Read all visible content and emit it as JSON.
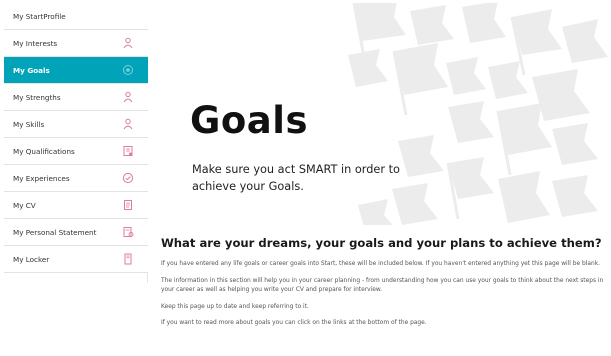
{
  "sidebar": {
    "items": [
      {
        "label": "My StartProfile",
        "icon": ""
      },
      {
        "label": "My Interests",
        "icon": "person-icon"
      },
      {
        "label": "My Goals",
        "icon": "goal-icon",
        "active": true
      },
      {
        "label": "My Strengths",
        "icon": "person-icon"
      },
      {
        "label": "My Skills",
        "icon": "person-icon"
      },
      {
        "label": "My Qualifications",
        "icon": "certificate-icon"
      },
      {
        "label": "My Experiences",
        "icon": "check-circle-icon"
      },
      {
        "label": "My CV",
        "icon": "document-icon"
      },
      {
        "label": "My Personal Statement",
        "icon": "statement-icon"
      },
      {
        "label": "My Locker",
        "icon": "locker-icon"
      }
    ]
  },
  "hero": {
    "title": "Goals",
    "subtitle": "Make sure you act SMART in order to achieve your Goals."
  },
  "content": {
    "heading": "What are your dreams, your goals and your plans to achieve them?",
    "paragraphs": [
      "If you have entered any life goals or career goals into Start, these will be included below.  If you haven't entered anything yet this page will be blank.",
      "The information in this section will help you in your career planning - from understanding how you can use your goals to think about the next steps in your career as well as helping you write your CV and prepare for interview.",
      "Keep this page up to date and keep referring to it.",
      "If you want to read more about goals you can click on the links at the bottom of the page."
    ]
  },
  "colors": {
    "accent": "#00a3b8",
    "icon_pink": "#e07aa0",
    "flag_grey": "#e9e9e9"
  }
}
